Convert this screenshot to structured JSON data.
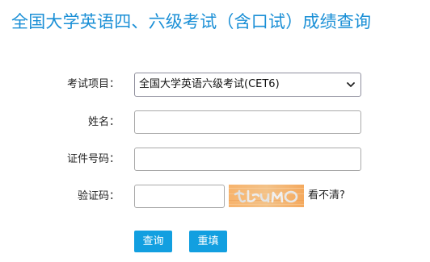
{
  "page": {
    "title": "全国大学英语四、六级考试（含口试）成绩查询"
  },
  "form": {
    "exam_label": "考试项目：",
    "exam_selected": "全国大学英语六级考试(CET6)",
    "name_label": "姓名：",
    "name_value": "",
    "id_label": "证件号码：",
    "id_value": "",
    "captcha_label": "验证码：",
    "captcha_value": "",
    "captcha_refresh": "看不清?"
  },
  "buttons": {
    "query": "查询",
    "reset": "重填"
  },
  "colors": {
    "accent": "#1a8fd6",
    "button": "#129fe0",
    "captcha_bg": "#f5b06a"
  }
}
